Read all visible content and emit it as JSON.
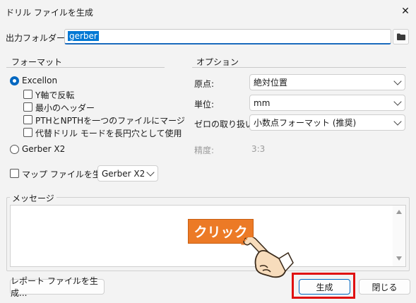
{
  "window": {
    "title": "ドリル ファイルを生成",
    "close_glyph": "✕"
  },
  "output_folder": {
    "label": "出力フォルダー:",
    "value": "gerber"
  },
  "format": {
    "title": "フォーマット",
    "excellon_label": "Excellon",
    "excellon_selected": true,
    "options": [
      {
        "label": "Y軸で反転",
        "checked": false
      },
      {
        "label": "最小のヘッダー",
        "checked": false
      },
      {
        "label": "PTHとNPTHを一つのファイルにマージ",
        "checked": false
      },
      {
        "label": "代替ドリル モードを長円穴として使用",
        "checked": false
      }
    ],
    "gerber_x2_label": "Gerber X2",
    "gerber_x2_selected": false
  },
  "map_file": {
    "label": "マップ ファイルを生成:",
    "checked": false,
    "format_value": "Gerber X2"
  },
  "options": {
    "title": "オプション",
    "origin_label": "原点:",
    "origin_value": "絶対位置",
    "unit_label": "単位:",
    "unit_value": "mm",
    "zeros_label": "ゼロの取り扱い:",
    "zeros_value": "小数点フォーマット (推奨)",
    "precision_label": "精度:",
    "precision_value": "3:3"
  },
  "messages": {
    "title": "メッセージ",
    "text": ""
  },
  "buttons": {
    "report": "レポート ファイルを生成...",
    "generate": "生成",
    "close": "閉じる"
  },
  "annotation": {
    "callout_text": "クリック",
    "callout_color": "#ec7a26",
    "highlight_color": "#e01010"
  },
  "colors": {
    "accent": "#0067c0",
    "selection": "#0078d4"
  }
}
